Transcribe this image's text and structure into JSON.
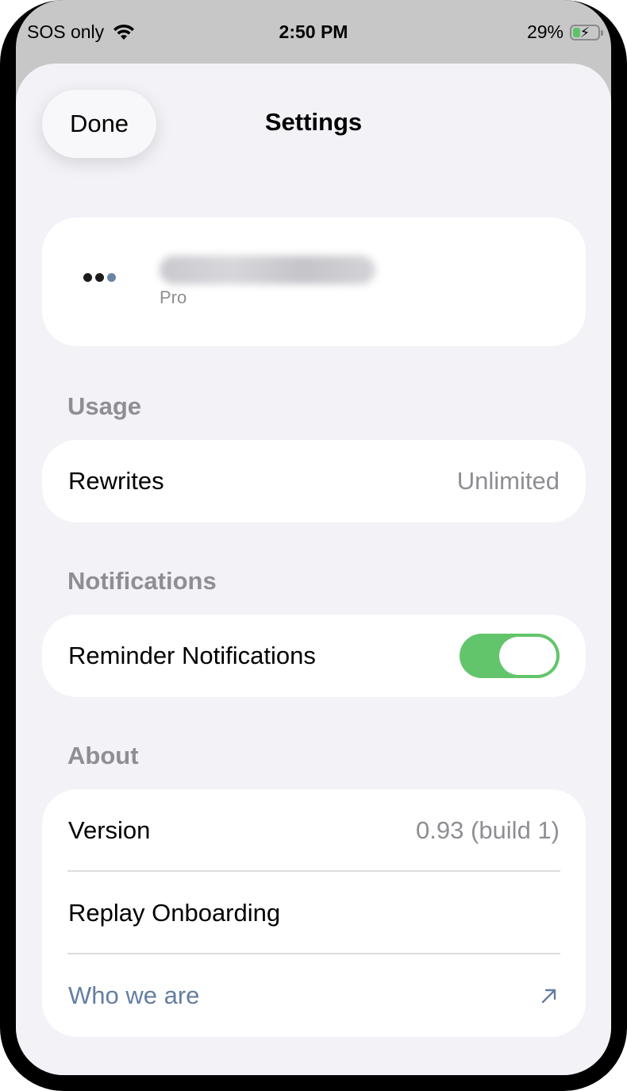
{
  "status_bar": {
    "carrier": "SOS only",
    "time": "2:50 PM",
    "battery_percent": "29%",
    "battery_level": 0.29,
    "charging": true
  },
  "header": {
    "done_label": "Done",
    "title": "Settings"
  },
  "account": {
    "email": "",
    "plan": "Pro"
  },
  "usage": {
    "header": "Usage",
    "rewrites_label": "Rewrites",
    "rewrites_value": "Unlimited"
  },
  "notifications": {
    "header": "Notifications",
    "reminder_label": "Reminder Notifications",
    "reminder_on": true
  },
  "about": {
    "header": "About",
    "version_label": "Version",
    "version_value": "0.93 (build 1)",
    "replay_label": "Replay Onboarding",
    "who_label": "Who we are"
  },
  "colors": {
    "toggle_on": "#63c56b",
    "link": "#647ea1",
    "secondary_text": "#8e8e93",
    "sheet_background": "#f2f2f7"
  },
  "icons": {
    "wifi": "wifi-icon",
    "battery": "battery-charging-icon",
    "more": "more-dots-icon",
    "external_link": "arrow-up-right-icon"
  }
}
